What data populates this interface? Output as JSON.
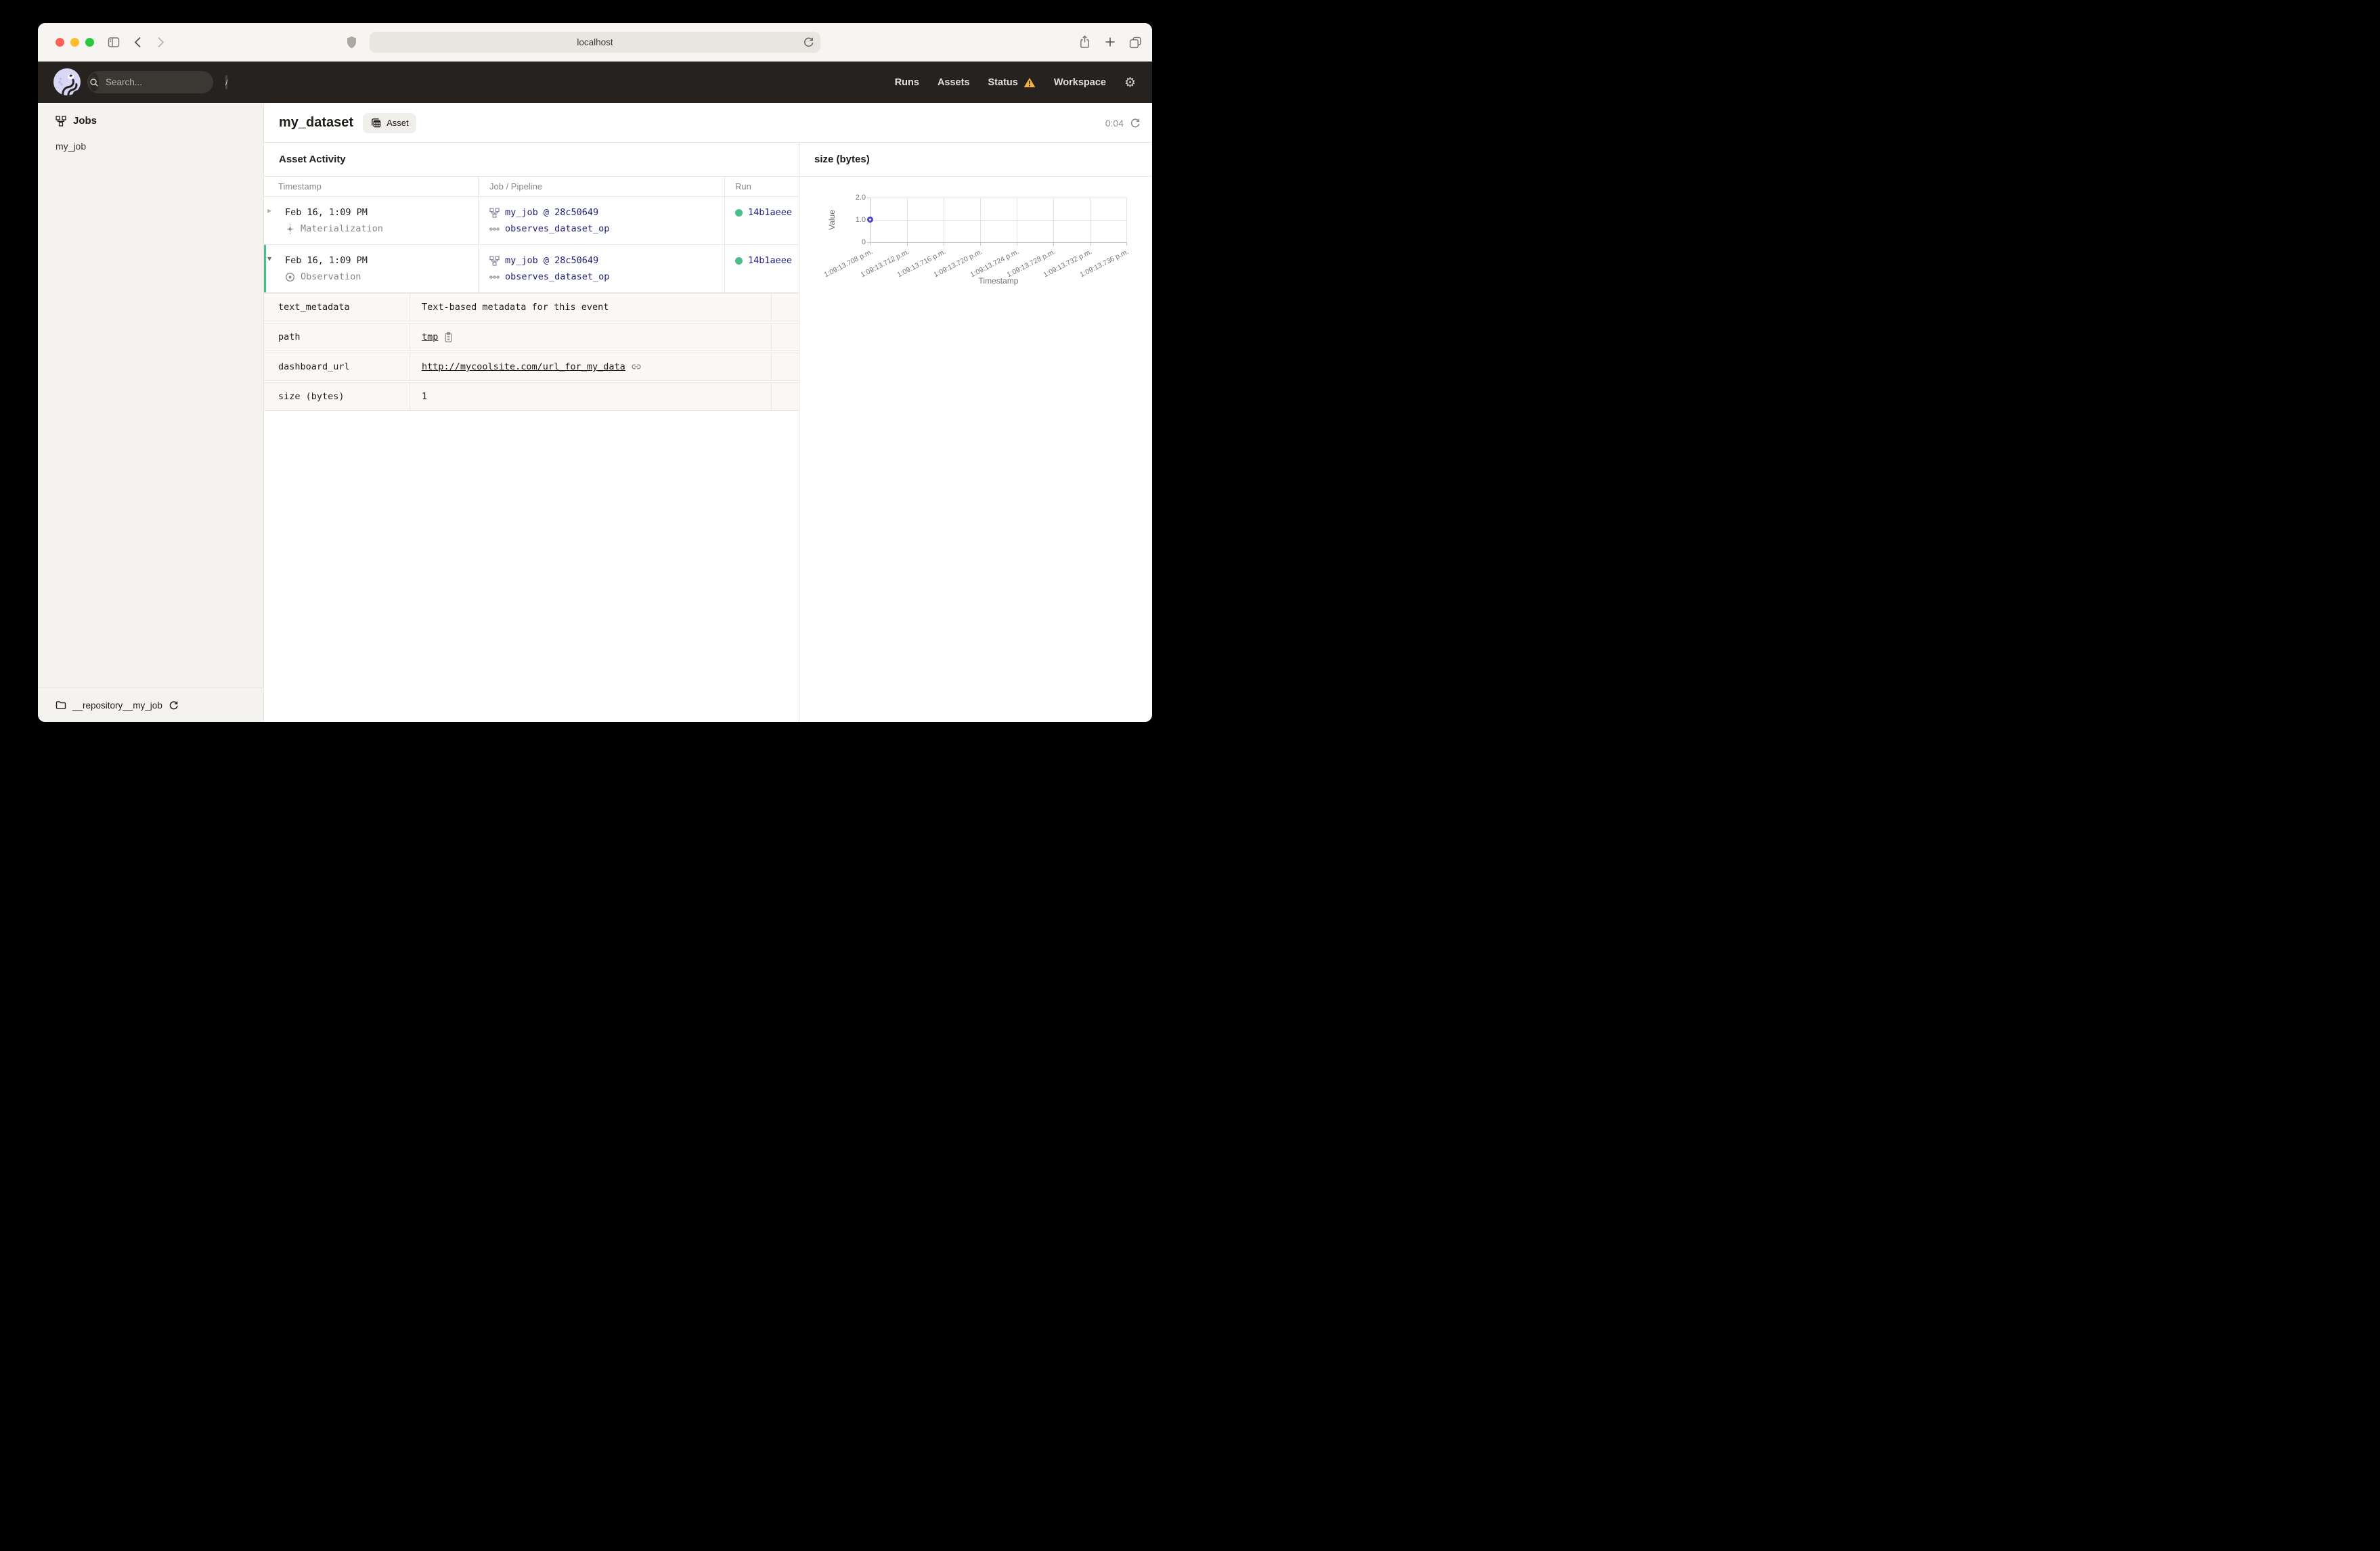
{
  "browser": {
    "url_text": "localhost"
  },
  "app_header": {
    "search_placeholder": "Search...",
    "search_shortcut": "/",
    "nav_runs": "Runs",
    "nav_assets": "Assets",
    "nav_status": "Status",
    "nav_workspace": "Workspace"
  },
  "sidebar": {
    "section_title": "Jobs",
    "job_item": "my_job",
    "repository_label": "__repository__my_job"
  },
  "main": {
    "title": "my_dataset",
    "asset_badge": "Asset",
    "timer": "0:04",
    "activity_heading": "Asset Activity",
    "columns": {
      "timestamp": "Timestamp",
      "job": "Job / Pipeline",
      "run": "Run"
    },
    "rows": [
      {
        "expander": "▸",
        "timestamp": "Feb 16, 1:09 PM",
        "event_type": "Materialization",
        "job": "my_job @ 28c50649",
        "op": "observes_dataset_op",
        "run_id": "14b1aeee"
      },
      {
        "expander": "▾",
        "timestamp": "Feb 16, 1:09 PM",
        "event_type": "Observation",
        "job": "my_job @ 28c50649",
        "op": "observes_dataset_op",
        "run_id": "14b1aeee"
      }
    ],
    "metadata": [
      {
        "key": "text_metadata",
        "value": "Text-based metadata for this event"
      },
      {
        "key": "path",
        "value": "tmp"
      },
      {
        "key": "dashboard_url",
        "value": "http://mycoolsite.com/url_for_my_data"
      },
      {
        "key": "size (bytes)",
        "value": "1"
      }
    ]
  },
  "chart_data": {
    "type": "scatter",
    "title": "size (bytes)",
    "xlabel": "Timestamp",
    "ylabel": "Value",
    "x_ticks": [
      "1:09:13.708 p.m.",
      "1:09:13.712 p.m.",
      "1:09:13.716 p.m.",
      "1:09:13.720 p.m.",
      "1:09:13.724 p.m.",
      "1:09:13.728 p.m.",
      "1:09:13.732 p.m.",
      "1:09:13.736 p.m."
    ],
    "y_ticks": [
      "2.0",
      "1.0",
      "0"
    ],
    "ylim": [
      0,
      2.3
    ],
    "points": [
      {
        "x": "1:09:13.708 p.m.",
        "y": 1.0
      }
    ],
    "grid": true,
    "legend": false,
    "point_color": "#4a46d6"
  },
  "colors": {
    "accent_green": "#4cbe8c",
    "link_navy": "#20207a",
    "warning_amber": "#f2b23e",
    "point_indigo": "#4a46d6",
    "header_bg": "#262220",
    "traffic_red": "#ff5f57",
    "traffic_yellow": "#febc2e",
    "traffic_green": "#28c840"
  }
}
